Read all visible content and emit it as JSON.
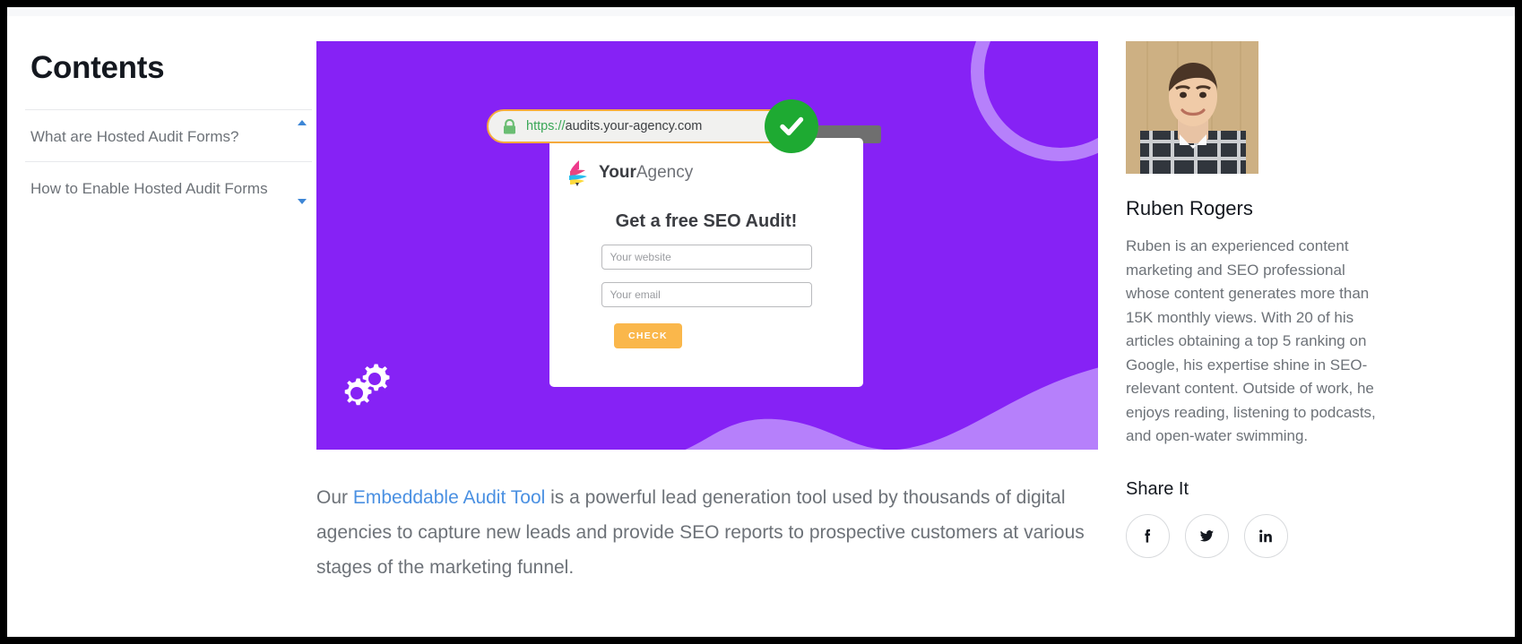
{
  "contents": {
    "title": "Contents",
    "items": [
      {
        "label": "What are Hosted Audit Forms?"
      },
      {
        "label": "How to Enable Hosted Audit Forms"
      }
    ]
  },
  "hero": {
    "background_color": "#8622f5",
    "accent_color": "#b680fb",
    "browser": {
      "url_scheme": "https://",
      "url_host": "audits.your-agency.com",
      "lock_icon": "lock-icon",
      "status_icon": "green-checkmark-icon",
      "border_color": "#f5a93c"
    },
    "form_card": {
      "logo_bold": "Your",
      "logo_light": "Agency",
      "heading": "Get a free SEO Audit!",
      "fields": [
        {
          "name": "website",
          "placeholder": "Your website",
          "value": ""
        },
        {
          "name": "email",
          "placeholder": "Your email",
          "value": ""
        }
      ],
      "submit_label": "CHECK",
      "submit_color": "#fab74b"
    },
    "decorations": [
      "gear-icon",
      "circle-outline",
      "wave-shape"
    ]
  },
  "article": {
    "paragraph_prefix": "Our ",
    "link_text": "Embeddable Audit Tool",
    "link_color": "#4a90e2",
    "paragraph_suffix": " is a powerful lead generation tool used by thousands of digital agencies to capture new leads and provide SEO reports to prospective customers at various stages of the marketing funnel."
  },
  "author": {
    "avatar_alt": "author-photo",
    "name": "Ruben Rogers",
    "bio": "Ruben is an experienced content marketing and SEO professional whose content generates more than 15K monthly views. With 20 of his articles obtaining a top 5 ranking on Google, his expertise shine in SEO-relevant content. Outside of work, he enjoys reading, listening to podcasts, and open-water swimming.",
    "share_title": "Share It",
    "socials": [
      {
        "name": "facebook",
        "glyph": "f"
      },
      {
        "name": "twitter",
        "glyph": "t"
      },
      {
        "name": "linkedin",
        "glyph": "in"
      }
    ]
  }
}
